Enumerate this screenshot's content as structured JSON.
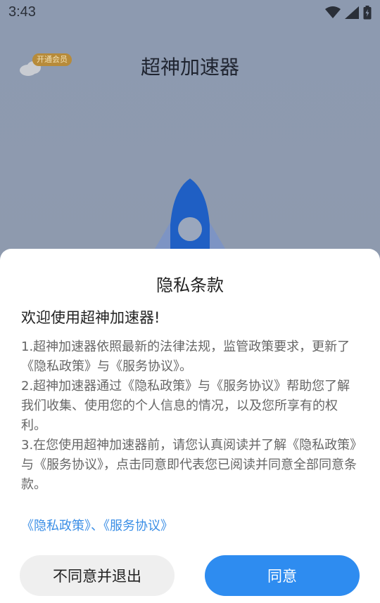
{
  "status_bar": {
    "time": "3:43",
    "icons": [
      "wifi-icon",
      "signal-icon",
      "battery-icon"
    ]
  },
  "app": {
    "title": "超神加速器",
    "vip_badge": "开通会员"
  },
  "dialog": {
    "title": "隐私条款",
    "welcome": "欢迎使用超神加速器!",
    "paragraphs": [
      "1.超神加速器依照最新的法律法规，监管政策要求，更新了《隐私政策》与《服务协议》。",
      " 2.超神加速器通过《隐私政策》与《服务协议》帮助您了解我们收集、使用您的个人信息的情况，以及您所享有的权利。",
      " 3.在您使用超神加速器前，请您认真阅读并了解《隐私政策》与《服务协议》，点击同意即代表您已阅读并同意全部同意条款。"
    ],
    "links": {
      "privacy": "《隐私政策》",
      "separator": "、",
      "service": "《服务协议》"
    },
    "buttons": {
      "decline": "不同意并退出",
      "agree": "同意"
    }
  },
  "colors": {
    "accent": "#2e8cf0",
    "link": "#3a8ee6",
    "dim_background": "#8d9ab0",
    "rocket": "#1f5fc4"
  }
}
